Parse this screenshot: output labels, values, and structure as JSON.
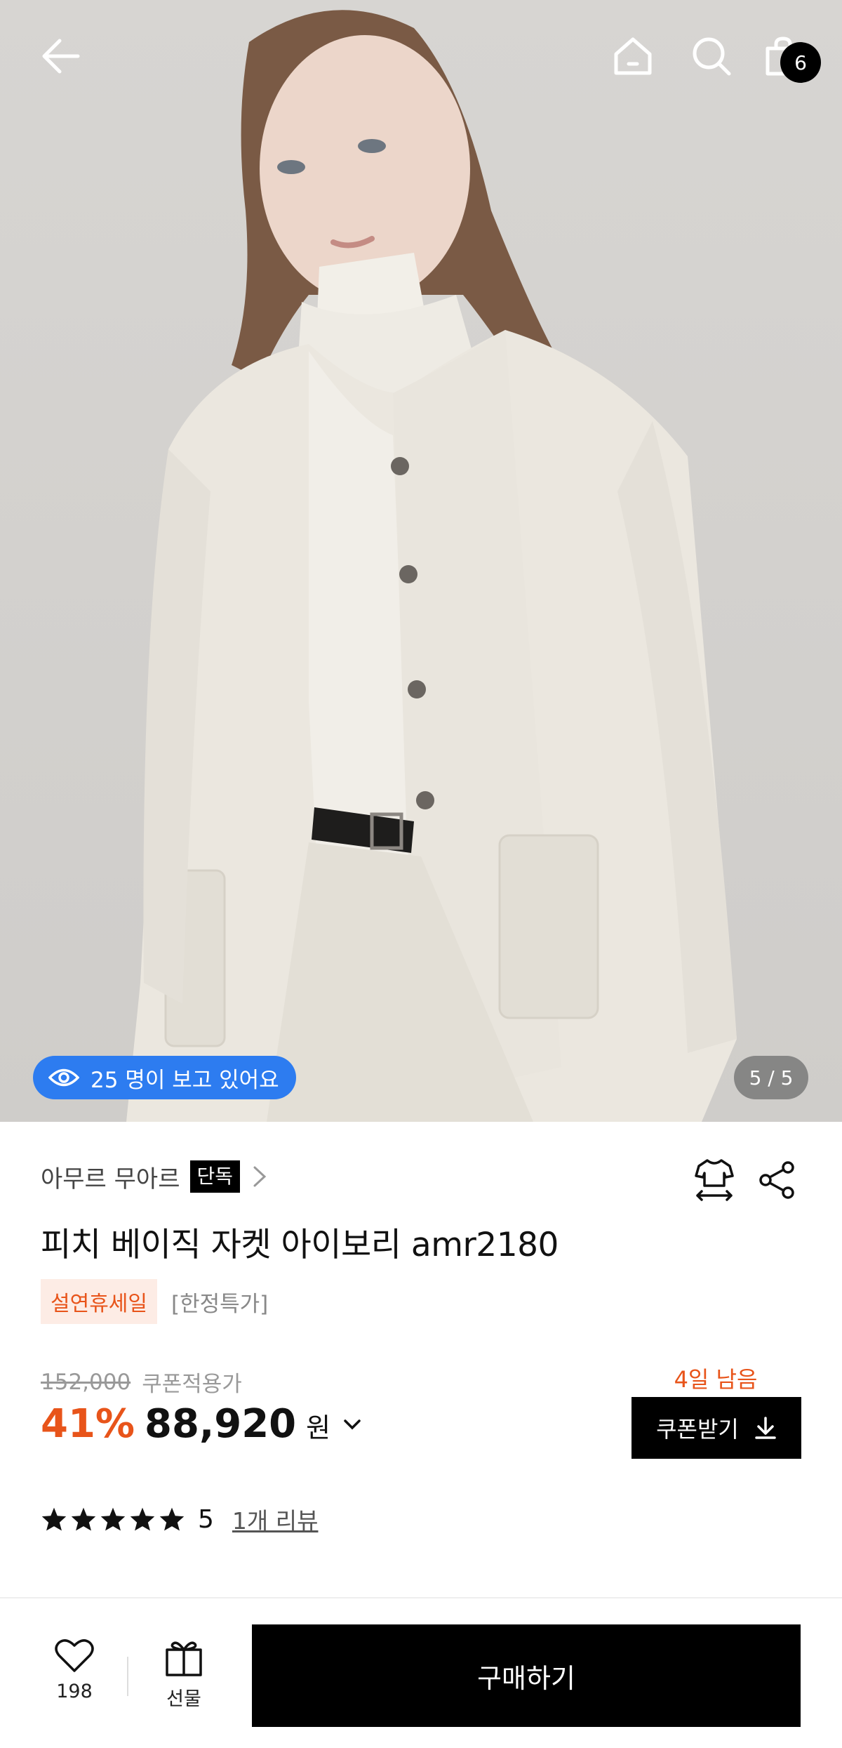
{
  "header": {
    "back_icon": "arrow-left-icon",
    "home_icon": "home-icon",
    "search_icon": "search-icon",
    "cart_icon": "shopping-bag-icon",
    "cart_count": "6"
  },
  "gallery": {
    "viewers_text": "25 명이 보고 있어요",
    "viewers_icon": "eye-icon",
    "counter": "5 / 5",
    "accent_color": "#2d7cf0"
  },
  "product": {
    "brand": "아무르 무아르",
    "exclusive_badge": "단독",
    "title": "피치 베이직 자켓 아이보리 amr2180",
    "sale_tag": "설연휴세일",
    "limited_tag": "[한정특가]",
    "size_icon": "size-guide-icon",
    "share_icon": "share-icon"
  },
  "pricing": {
    "original_price": "152,000",
    "coupon_label": "쿠폰적용가",
    "discount": "41%",
    "price": "88,920",
    "currency": "원",
    "days_left": "4일 남음",
    "coupon_button": "쿠폰받기",
    "accent_color": "#e8541a"
  },
  "reviews": {
    "rating": "5",
    "stars": 5,
    "review_link": "1개 리뷰"
  },
  "bottom_bar": {
    "like_count": "198",
    "gift_label": "선물",
    "buy_button": "구매하기"
  }
}
